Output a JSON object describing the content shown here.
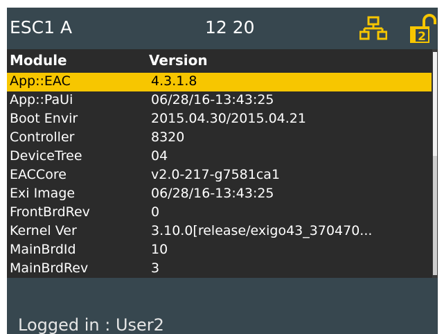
{
  "header": {
    "title": "ESC1 A",
    "time": "12 20",
    "network_icon": "network-icon",
    "lock_icon": "unlocked-padlock-icon",
    "lock_level": "2",
    "accent_color": "#f7c600"
  },
  "table": {
    "columns": [
      "Module",
      "Version"
    ],
    "selected_index": 0,
    "rows": [
      {
        "module": "App::EAC",
        "version": "4.3.1.8"
      },
      {
        "module": "App::PaUi",
        "version": "06/28/16-13:43:25"
      },
      {
        "module": "Boot Envir",
        "version": "2015.04.30/2015.04.21"
      },
      {
        "module": "Controller",
        "version": "8320"
      },
      {
        "module": "DeviceTree",
        "version": "04"
      },
      {
        "module": "EACCore",
        "version": "v2.0-217-g7581ca1"
      },
      {
        "module": "Exi Image",
        "version": "06/28/16-13:43:25"
      },
      {
        "module": "FrontBrdRev",
        "version": "0"
      },
      {
        "module": "Kernel Ver",
        "version": "3.10.0[release/exigo43_370470..."
      },
      {
        "module": "MainBrdId",
        "version": "10"
      },
      {
        "module": "MainBrdRev",
        "version": "3"
      }
    ]
  },
  "footer": {
    "status": "Logged in : User2"
  }
}
